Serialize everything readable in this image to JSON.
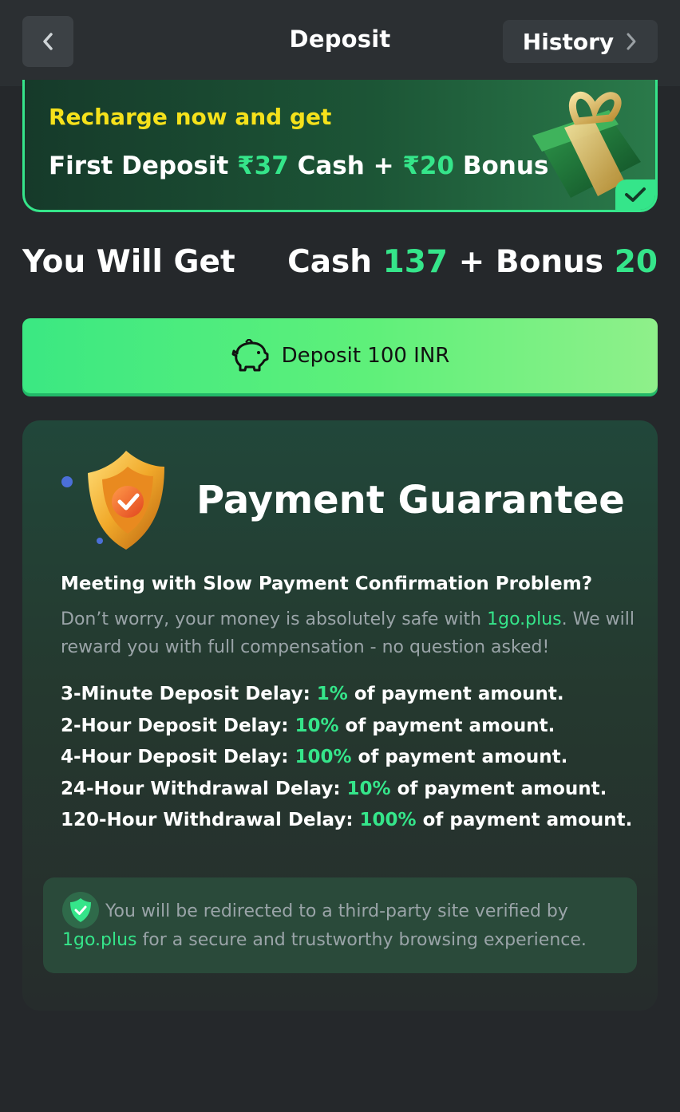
{
  "header": {
    "title": "Deposit",
    "history_label": "History"
  },
  "promo": {
    "headline": "Recharge now and get",
    "prefix": "First Deposit ",
    "cash_amount": "₹37",
    "cash_word": " Cash + ",
    "bonus_amount": "₹20",
    "bonus_word": " Bonus"
  },
  "summary": {
    "label": "You Will Get",
    "cash_word": "Cash ",
    "cash_value": "137",
    "plus": " + Bonus ",
    "bonus_value": "20"
  },
  "deposit_button": {
    "label": "Deposit 100 INR"
  },
  "guarantee": {
    "title": "Payment Guarantee",
    "question": "Meeting with Slow Payment Confirmation Problem?",
    "reassure_pre": "Don’t worry, your money is absolutely safe with ",
    "site": "1go.plus",
    "reassure_post": ". We will reward you with full compensation - no question asked!",
    "rules": [
      {
        "label": "3-Minute Deposit Delay: ",
        "pct": "1%",
        "suffix": " of payment amount."
      },
      {
        "label": "2-Hour Deposit Delay: ",
        "pct": "10%",
        "suffix": " of payment amount."
      },
      {
        "label": "4-Hour Deposit Delay: ",
        "pct": "100%",
        "suffix": " of payment amount."
      },
      {
        "label": "24-Hour Withdrawal Delay: ",
        "pct": "10%",
        "suffix": " of payment amount."
      },
      {
        "label": "120-Hour Withdrawal Delay: ",
        "pct": "100%",
        "suffix": " of payment amount."
      }
    ],
    "notice_pre": "You will be redirected to a third-party site verified by ",
    "notice_site": "1go.plus",
    "notice_post": " for a secure and trustworthy browsing experience."
  },
  "colors": {
    "accent_green": "#35e58a",
    "headline_yellow": "#f5e11b",
    "background": "#25282b"
  },
  "icons": [
    "chevron-left-icon",
    "chevron-right-icon",
    "gift-icon",
    "check-icon",
    "piggy-bank-icon",
    "shield-icon",
    "shield-check-icon"
  ]
}
